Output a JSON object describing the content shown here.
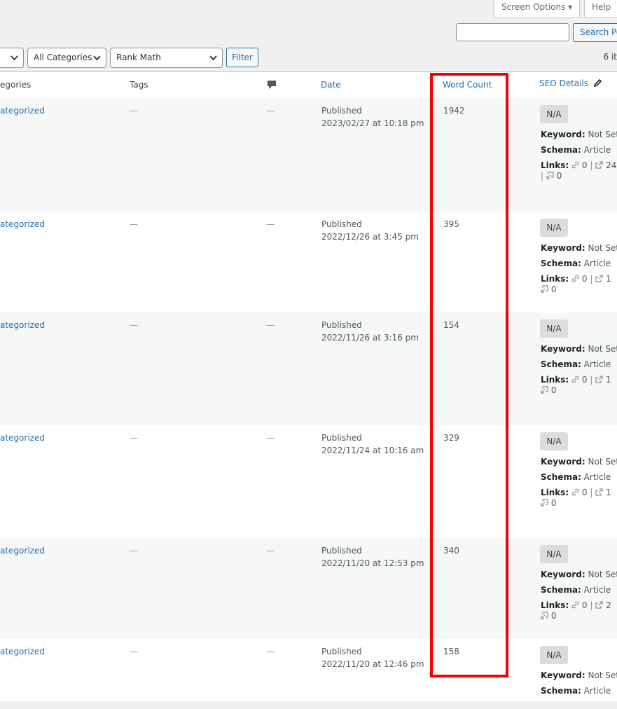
{
  "top_buttons": {
    "screen_options": "Screen Options ▾",
    "help": "Help"
  },
  "search": {
    "value": "",
    "button_label": "Search Pos"
  },
  "filters": {
    "dates_select": "",
    "categories_select": "All Categories",
    "seo_select": "Rank Math",
    "filter_label": "Filter"
  },
  "items_count": "6 it",
  "columns": {
    "categories": "egories",
    "tags": "Tags",
    "comments_icon": "comment-bubble-icon",
    "date": "Date",
    "word_count": "Word Count",
    "seo_details": "SEO Details"
  },
  "rows": [
    {
      "category": "ategorized",
      "tags": "—",
      "comments": "—",
      "status": "Published",
      "date": "2023/02/27 at 10:18 pm",
      "word_count": "1942",
      "score": "N/A",
      "keyword_label": "Keyword:",
      "keyword": "Not Set",
      "schema_label": "Schema:",
      "schema": "Article",
      "links_label": "Links:",
      "internal": "0",
      "sep": "|",
      "external": "24",
      "sep2": "|",
      "incoming": "0"
    },
    {
      "category": "ategorized",
      "tags": "—",
      "comments": "—",
      "status": "Published",
      "date": "2022/12/26 at 3:45 pm",
      "word_count": "395",
      "score": "N/A",
      "keyword_label": "Keyword:",
      "keyword": "Not Set",
      "schema_label": "Schema:",
      "schema": "Article",
      "links_label": "Links:",
      "internal": "0",
      "sep": "|",
      "external": "1",
      "incoming": "0"
    },
    {
      "category": "ategorized",
      "tags": "—",
      "comments": "—",
      "status": "Published",
      "date": "2022/11/26 at 3:16 pm",
      "word_count": "154",
      "score": "N/A",
      "keyword_label": "Keyword:",
      "keyword": "Not Set",
      "schema_label": "Schema:",
      "schema": "Article",
      "links_label": "Links:",
      "internal": "0",
      "sep": "|",
      "external": "1",
      "incoming": "0"
    },
    {
      "category": "ategorized",
      "tags": "—",
      "comments": "—",
      "status": "Published",
      "date": "2022/11/24 at 10:16 am",
      "word_count": "329",
      "score": "N/A",
      "keyword_label": "Keyword:",
      "keyword": "Not Set",
      "schema_label": "Schema:",
      "schema": "Article",
      "links_label": "Links:",
      "internal": "0",
      "sep": "|",
      "external": "1",
      "incoming": "0"
    },
    {
      "category": "ategorized",
      "tags": "—",
      "comments": "—",
      "status": "Published",
      "date": "2022/11/20 at 12:53 pm",
      "word_count": "340",
      "score": "N/A",
      "keyword_label": "Keyword:",
      "keyword": "Not Set",
      "schema_label": "Schema:",
      "schema": "Article",
      "links_label": "Links:",
      "internal": "0",
      "sep": "|",
      "external": "2",
      "incoming": "0"
    },
    {
      "category": "ategorized",
      "tags": "—",
      "comments": "—",
      "status": "Published",
      "date": "2022/11/20 at 12:46 pm",
      "word_count": "158",
      "score": "N/A",
      "keyword_label": "Keyword:",
      "keyword": "Not Set",
      "schema_label": "Schema:",
      "schema": "Article"
    }
  ],
  "colors": {
    "link": "#2271b1",
    "highlight": "#f40000",
    "alt_row": "#f6f7f7",
    "badge": "#dcdcde"
  }
}
